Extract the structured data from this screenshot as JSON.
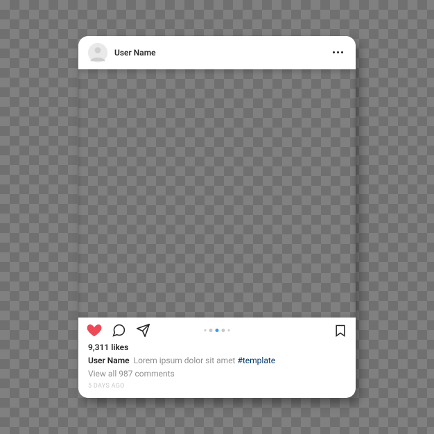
{
  "header": {
    "username": "User Name"
  },
  "post": {
    "likes_text": "9,311 likes",
    "caption_username": "User Name",
    "caption_text": "Lorem ipsum dolor sit amet ",
    "caption_hashtag": "#template",
    "view_comments_text": "View all 987 comments",
    "timestamp": "5 DAYS AGO"
  },
  "pagination": {
    "total": 5,
    "active_index": 2
  },
  "icons": {
    "like": "heart-icon",
    "comment": "comment-icon",
    "share": "send-icon",
    "save": "bookmark-icon",
    "more": "more-icon",
    "avatar": "avatar-placeholder-icon"
  },
  "colors": {
    "like_active": "#ed4956",
    "accent_blue": "#3897f0",
    "hashtag": "#00376b"
  }
}
